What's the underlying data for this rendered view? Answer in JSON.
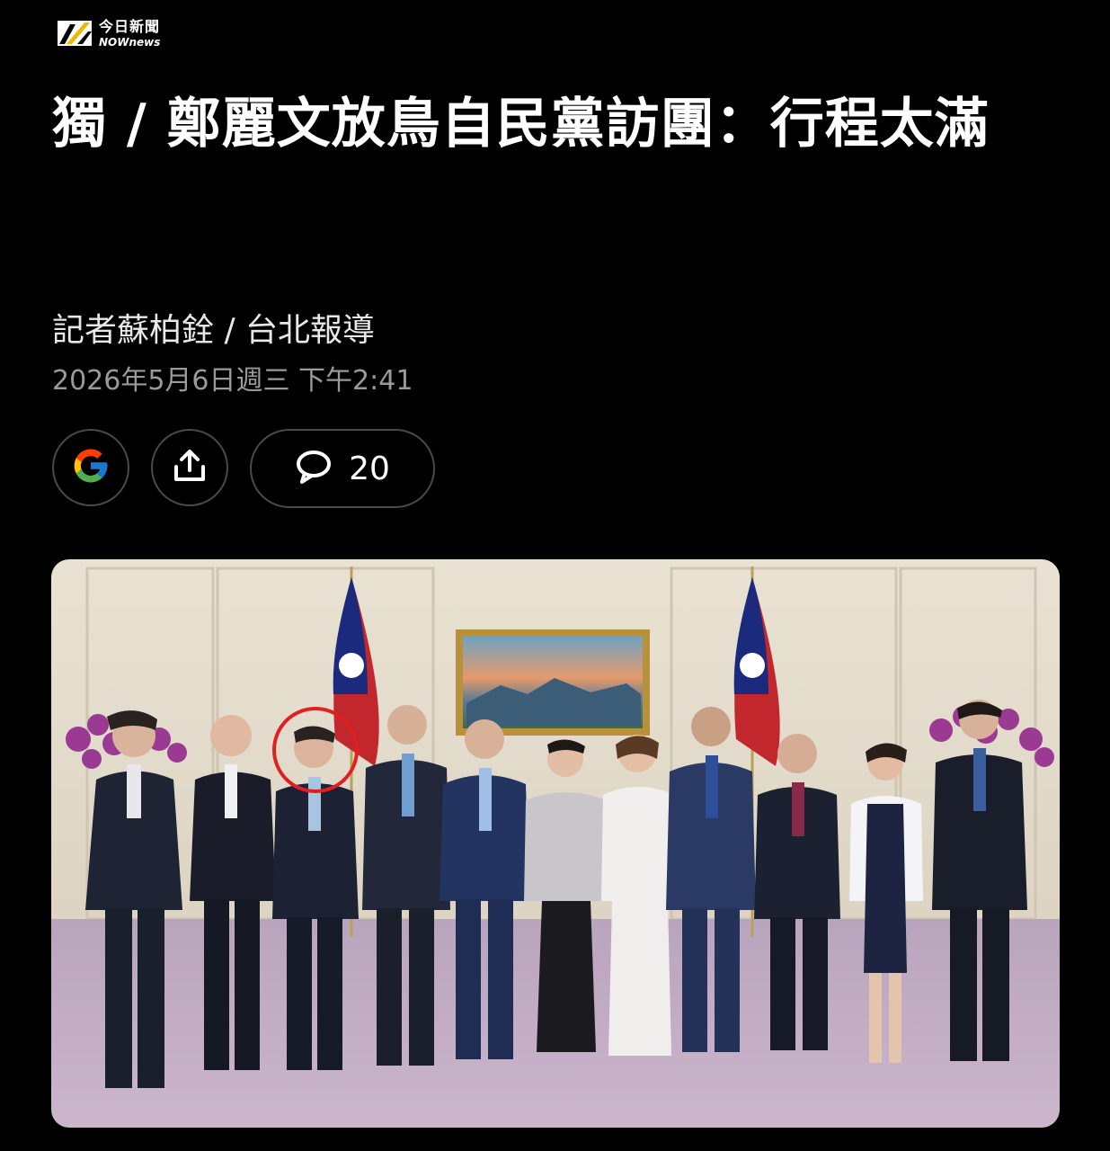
{
  "brand": {
    "name_cn": "今日新聞",
    "name_en": "NOWnews"
  },
  "article": {
    "headline": "獨 / 鄭麗文放鳥自民黨訪團：行程太滿",
    "byline": "記者蘇柏銓 / 台北報導",
    "date": "2026年5月6日週三 下午2:41"
  },
  "actions": {
    "google_icon": "google-icon",
    "share_icon": "share-icon",
    "comment_icon": "comment-icon",
    "comment_count": "20"
  },
  "photo": {
    "description_icon": "article-photo"
  },
  "colors": {
    "background": "#000000",
    "headline": "#ffffff",
    "date": "#9a9a9a",
    "button_border": "#4a4a4a",
    "logo_accent": "#f2b705",
    "circle_highlight": "#e02020"
  }
}
